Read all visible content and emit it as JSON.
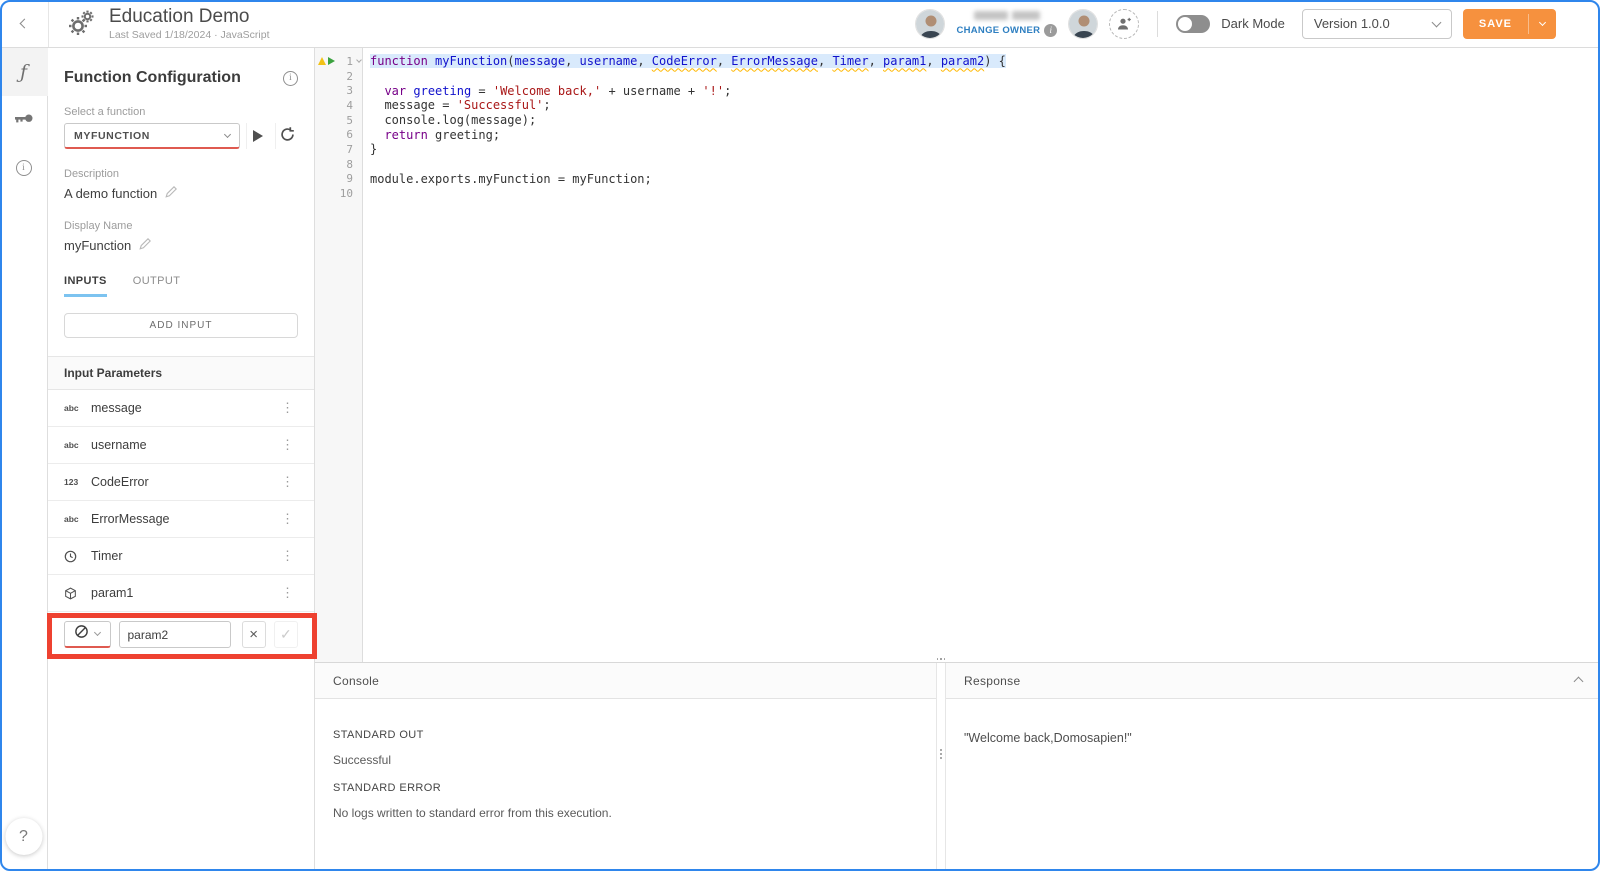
{
  "colors": {
    "accent_orange": "#f6913e",
    "annotation_red": "#ee4130",
    "link_blue": "#2e7fc1",
    "tab_underline_blue": "#7cc3f0",
    "frame_blue": "#2f86ec",
    "error_underline_red": "#df5a50",
    "code_keyword": "#770088",
    "code_variable": "#1111cc",
    "code_string": "#a91717",
    "line_highlight": "#d9eafc"
  },
  "header": {
    "title": "Education Demo",
    "subtitle": "Last Saved 1/18/2024 · JavaScript",
    "owner": {
      "name_redacted": true,
      "change_owner_label": "CHANGE OWNER"
    },
    "dark_mode_label": "Dark Mode",
    "version_value": "Version 1.0.0",
    "save_label": "SAVE"
  },
  "sidebar": {
    "items": [
      {
        "icon": "function-icon",
        "active": true
      },
      {
        "icon": "key-icon",
        "active": false
      },
      {
        "icon": "info-icon",
        "active": false
      }
    ],
    "help_icon": "question-icon"
  },
  "panel": {
    "title": "Function Configuration",
    "select_label": "Select a function",
    "select_value": "MYFUNCTION",
    "description_label": "Description",
    "description_value": "A demo function",
    "display_name_label": "Display Name",
    "display_name_value": "myFunction",
    "tabs": [
      {
        "label": "INPUTS",
        "active": true
      },
      {
        "label": "OUTPUT",
        "active": false
      }
    ],
    "add_input_label": "ADD INPUT",
    "params_header": "Input Parameters",
    "params": [
      {
        "icon": "text-type-icon",
        "icon_label": "abc",
        "name": "message"
      },
      {
        "icon": "text-type-icon",
        "icon_label": "abc",
        "name": "username"
      },
      {
        "icon": "number-type-icon",
        "icon_label": "123",
        "name": "CodeError"
      },
      {
        "icon": "text-type-icon",
        "icon_label": "abc",
        "name": "ErrorMessage"
      },
      {
        "icon": "datetime-type-icon",
        "icon_label": "",
        "name": "Timer"
      },
      {
        "icon": "object-type-icon",
        "icon_label": "",
        "name": "param1"
      }
    ],
    "edit_row": {
      "type_icon": "null-type-icon",
      "value": "param2"
    }
  },
  "editor": {
    "language": "JavaScript",
    "lines": [
      {
        "num": 1,
        "selected": true,
        "markers": [
          "warning",
          "play"
        ],
        "fold": true,
        "tokens": [
          {
            "c": "k",
            "t": "function"
          },
          {
            "c": "p",
            "t": " "
          },
          {
            "c": "d",
            "t": "myFunction"
          },
          {
            "c": "p",
            "t": "("
          },
          {
            "c": "d",
            "t": "message"
          },
          {
            "c": "p",
            "t": ", "
          },
          {
            "c": "d",
            "t": "username"
          },
          {
            "c": "p",
            "t": ", "
          },
          {
            "c": "u",
            "t": "CodeError"
          },
          {
            "c": "p",
            "t": ", "
          },
          {
            "c": "u",
            "t": "ErrorMessage"
          },
          {
            "c": "p",
            "t": ", "
          },
          {
            "c": "u",
            "t": "Timer"
          },
          {
            "c": "p",
            "t": ", "
          },
          {
            "c": "u",
            "t": "param1"
          },
          {
            "c": "p",
            "t": ", "
          },
          {
            "c": "u",
            "t": "param2"
          },
          {
            "c": "p",
            "t": ") {"
          }
        ]
      },
      {
        "num": 2,
        "tokens": []
      },
      {
        "num": 3,
        "tokens": [
          {
            "c": "p",
            "t": "  "
          },
          {
            "c": "k",
            "t": "var"
          },
          {
            "c": "p",
            "t": " "
          },
          {
            "c": "d",
            "t": "greeting"
          },
          {
            "c": "p",
            "t": " = "
          },
          {
            "c": "s",
            "t": "'Welcome back,'"
          },
          {
            "c": "p",
            "t": " + username + "
          },
          {
            "c": "s",
            "t": "'!'"
          },
          {
            "c": "p",
            "t": ";"
          }
        ]
      },
      {
        "num": 4,
        "tokens": [
          {
            "c": "p",
            "t": "  message = "
          },
          {
            "c": "s",
            "t": "'Successful'"
          },
          {
            "c": "p",
            "t": ";"
          }
        ]
      },
      {
        "num": 5,
        "tokens": [
          {
            "c": "p",
            "t": "  console.log(message);"
          }
        ]
      },
      {
        "num": 6,
        "tokens": [
          {
            "c": "p",
            "t": "  "
          },
          {
            "c": "k",
            "t": "return"
          },
          {
            "c": "p",
            "t": " greeting;"
          }
        ]
      },
      {
        "num": 7,
        "tokens": [
          {
            "c": "p",
            "t": "}"
          }
        ]
      },
      {
        "num": 8,
        "tokens": []
      },
      {
        "num": 9,
        "tokens": [
          {
            "c": "p",
            "t": "module.exports.myFunction = myFunction;"
          }
        ]
      },
      {
        "num": 10,
        "tokens": []
      }
    ]
  },
  "console": {
    "title": "Console",
    "sections": [
      {
        "label": "STANDARD OUT",
        "text": "Successful"
      },
      {
        "label": "STANDARD ERROR",
        "text": "No logs written to standard error from this execution."
      }
    ]
  },
  "response": {
    "title": "Response",
    "value": "\"Welcome back,Domosapien!\""
  }
}
